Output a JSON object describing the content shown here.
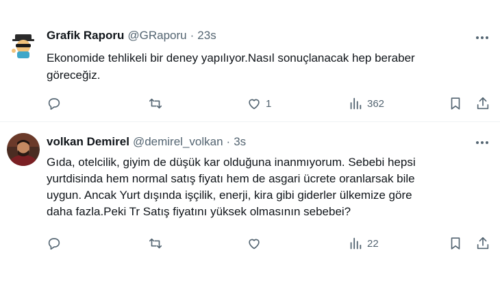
{
  "tweets": [
    {
      "name": "Grafik Raporu",
      "handle": "@GRaporu",
      "separator": "·",
      "time": "23s",
      "text": "Ekonomide tehlikeli bir deney yapılıyor.Nasıl sonuçlanacak hep beraber\ngöreceğiz.",
      "likes": "1",
      "views": "362",
      "avatar_icon": "sunglasses-character-icon"
    },
    {
      "name": "volkan Demirel",
      "handle": "@demirel_volkan",
      "separator": "·",
      "time": "3s",
      "text": "Gıda, otelcilik, giyim de düşük kar olduğuna inanmıyorum. Sebebi hepsi\nyurtdisinda hem normal satış fiyatı hem de asgari ücrete oranlarsak bile\nuygun. Ancak Yurt dışında işçilik, enerji, kira gibi giderler ülkemize göre\ndaha fazla.Peki Tr Satış fiyatını yüksek olmasının  sebebei?",
      "likes": "",
      "views": "22",
      "avatar_icon": "user-photo"
    }
  ],
  "colors": {
    "text_primary": "#0f1419",
    "text_secondary": "#536471",
    "divider": "#eff3f4",
    "background": "#ffffff"
  },
  "icons": [
    "reply-icon",
    "retweet-icon",
    "like-icon",
    "views-icon",
    "bookmark-icon",
    "share-icon",
    "more-icon"
  ]
}
